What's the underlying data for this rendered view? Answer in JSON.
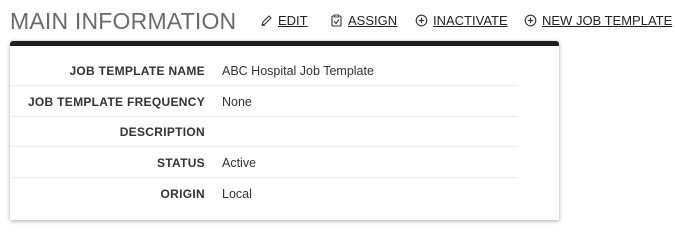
{
  "page": {
    "title": "MAIN INFORMATION"
  },
  "actions": {
    "edit": {
      "label": "EDIT",
      "icon": "pencil-icon"
    },
    "assign": {
      "label": "ASSIGN",
      "icon": "clipboard-check-icon"
    },
    "inactivate": {
      "label": "INACTIVATE",
      "icon": "plus-circle-icon"
    },
    "new_job_template": {
      "label": "NEW JOB TEMPLATE",
      "icon": "plus-circle-icon"
    }
  },
  "details": [
    {
      "label": "JOB TEMPLATE NAME",
      "value": "ABC Hospital Job Template"
    },
    {
      "label": "JOB TEMPLATE FREQUENCY",
      "value": "None"
    },
    {
      "label": "DESCRIPTION",
      "value": ""
    },
    {
      "label": "STATUS",
      "value": "Active"
    },
    {
      "label": "ORIGIN",
      "value": "Local"
    }
  ],
  "colors": {
    "panel_top_border": "#1e1e1e",
    "title": "#6b6b6b",
    "text": "#333333"
  }
}
